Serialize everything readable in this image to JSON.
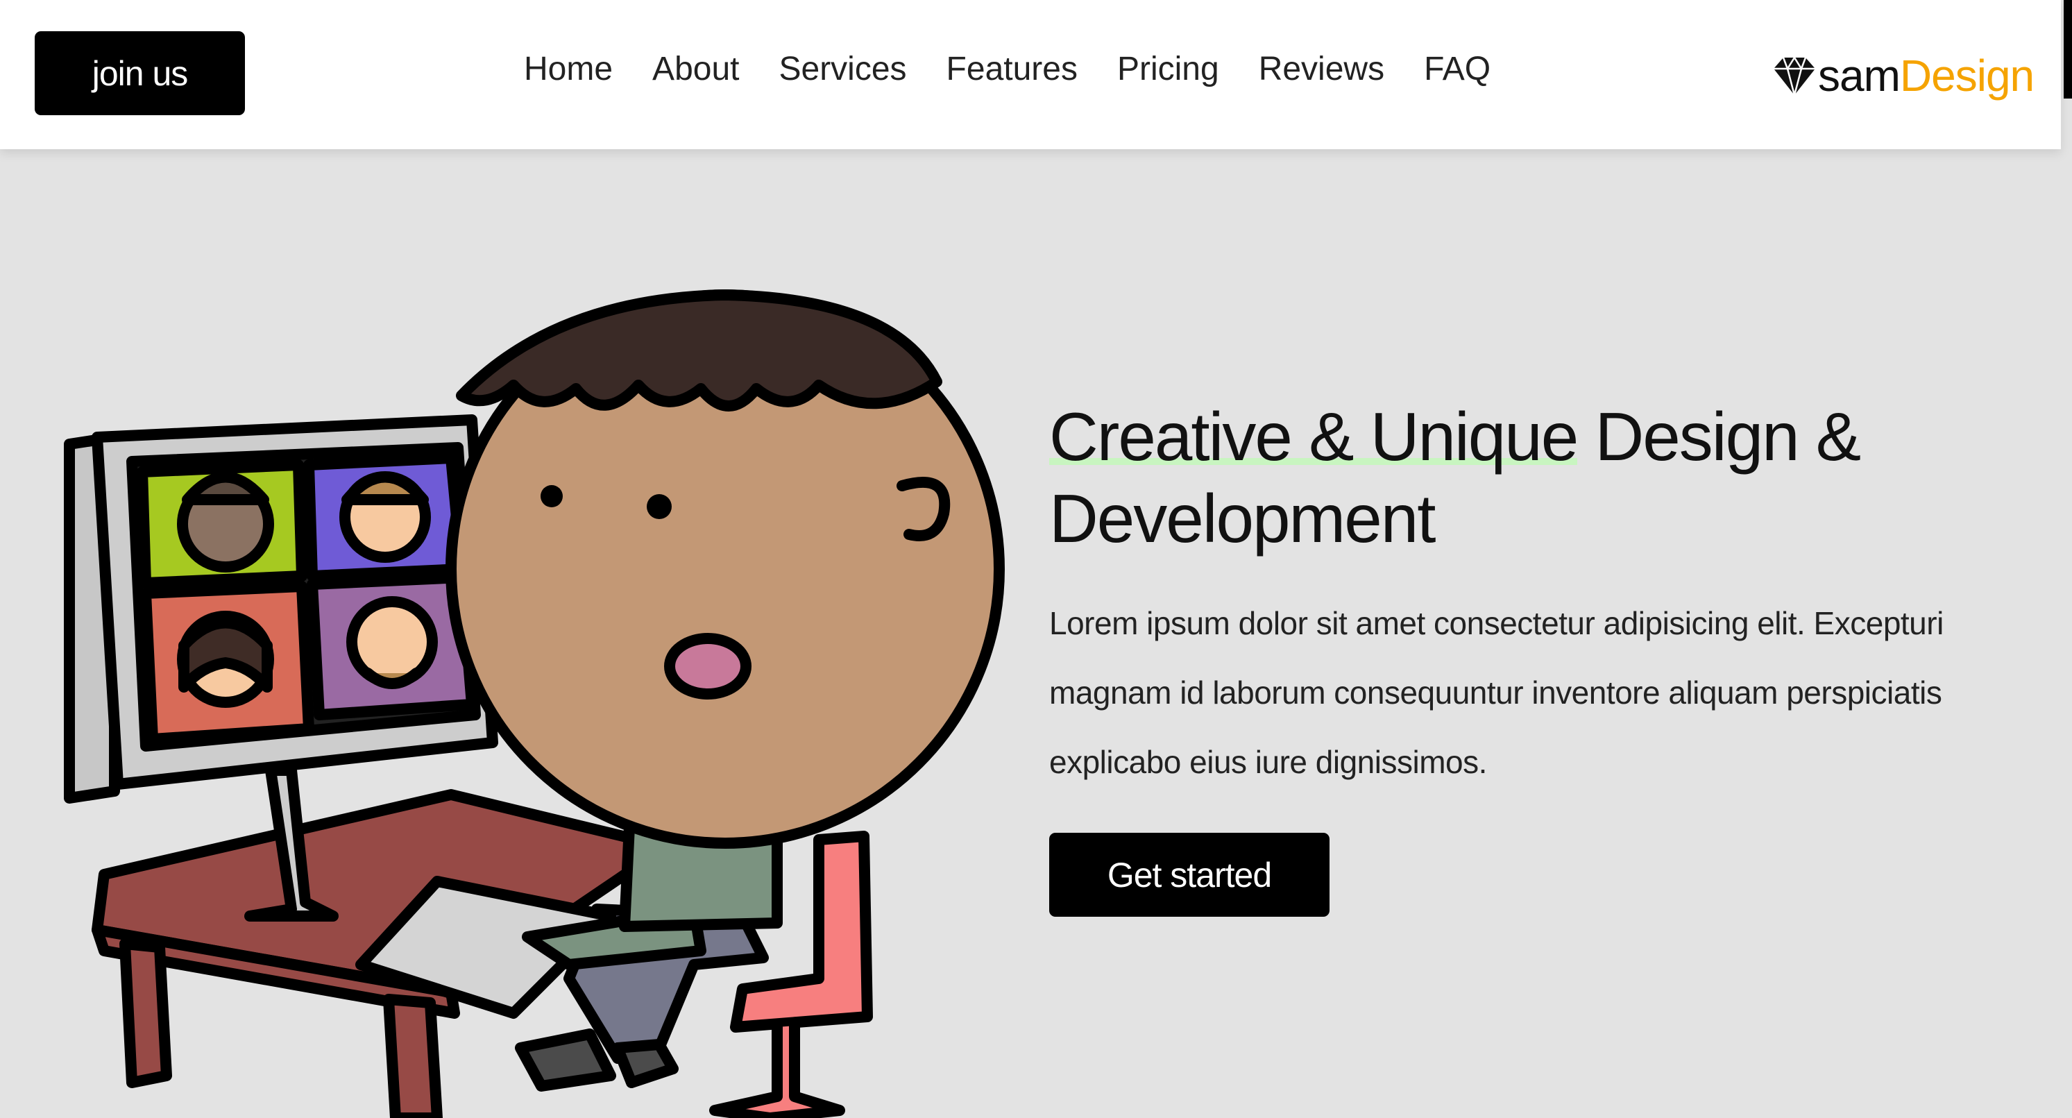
{
  "header": {
    "join_label": "join us",
    "nav": [
      "Home",
      "About",
      "Services",
      "Features",
      "Pricing",
      "Reviews",
      "FAQ"
    ],
    "logo": {
      "icon": "diamond-icon",
      "part1": "sam",
      "part2": "Design",
      "accent": "#f5a300"
    }
  },
  "hero": {
    "title_highlight": "Creative & Unique",
    "title_rest": " Design & Development",
    "description": "Lorem ipsum dolor sit amet consectetur adipisicing elit. Excepturi magnam id laborum consequuntur inventore aliquam perspiciatis explicabo eius iure dignissimos.",
    "cta_label": "Get started",
    "highlight_color": "#c8f5c0"
  },
  "colors": {
    "page_background": "#e3e3e3",
    "header_background": "#ffffff",
    "button_background": "#000000"
  },
  "illustration": {
    "subject": "boy-at-computer-video-call-illustration"
  }
}
